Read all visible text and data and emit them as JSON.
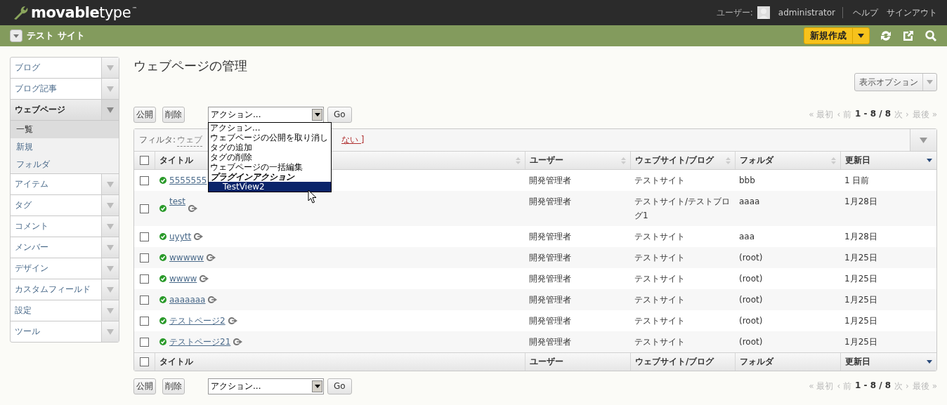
{
  "header": {
    "logo": [
      "movable",
      "type"
    ],
    "trademark": "™",
    "user_label": "ユーザー:",
    "user_name": "administrator",
    "links": [
      "ヘルプ",
      "サインアウト"
    ]
  },
  "site_bar": {
    "site_name": "テスト サイト",
    "new_button": "新規作成"
  },
  "sidebar": {
    "items": [
      {
        "label": "ブログ",
        "selected": false,
        "expanded": false
      },
      {
        "label": "ブログ記事",
        "selected": false,
        "expanded": false
      },
      {
        "label": "ウェブページ",
        "selected": true,
        "expanded": true,
        "children": [
          {
            "label": "一覧",
            "selected": true
          },
          {
            "label": "新規",
            "selected": false
          },
          {
            "label": "フォルダ",
            "selected": false
          }
        ]
      },
      {
        "label": "アイテム",
        "selected": false,
        "expanded": false
      },
      {
        "label": "タグ",
        "selected": false,
        "expanded": false
      },
      {
        "label": "コメント",
        "selected": false,
        "expanded": false
      },
      {
        "label": "メンバー",
        "selected": false,
        "expanded": false
      },
      {
        "label": "デザイン",
        "selected": false,
        "expanded": false
      },
      {
        "label": "カスタムフィールド",
        "selected": false,
        "expanded": false
      },
      {
        "label": "設定",
        "selected": false,
        "expanded": false
      },
      {
        "label": "ツール",
        "selected": false,
        "expanded": false
      }
    ]
  },
  "page_title": "ウェブページの管理",
  "display_options": "表示オプション",
  "actions_top": {
    "buttons": [
      "公開",
      "削除"
    ],
    "select": "アクション...",
    "go": "Go"
  },
  "actions_bottom": {
    "buttons": [
      "公開",
      "削除"
    ],
    "select": "アクション...",
    "go": "Go"
  },
  "action_menu": [
    {
      "kind": "option",
      "label": "アクション...",
      "selected": false
    },
    {
      "kind": "option",
      "label": "ウェブページの公開を取り消し",
      "selected": false
    },
    {
      "kind": "option",
      "label": "タグの追加",
      "selected": false
    },
    {
      "kind": "option",
      "label": "タグの削除",
      "selected": false
    },
    {
      "kind": "option",
      "label": "ウェブページの一括編集",
      "selected": false
    },
    {
      "kind": "group",
      "label": "プラグインアクション",
      "selected": false
    },
    {
      "kind": "option",
      "label": "TestView2",
      "selected": true
    }
  ],
  "pagination": [
    {
      "label": "« 最初",
      "disabled": true
    },
    {
      "label": "‹ 前",
      "disabled": true
    },
    {
      "label": "1 - 8 / 8",
      "disabled": false
    },
    {
      "label": "次 ›",
      "disabled": true
    },
    {
      "label": "最後 »",
      "disabled": true
    }
  ],
  "pagination_bottom": [
    {
      "label": "« 最初",
      "disabled": true
    },
    {
      "label": "‹ 前",
      "disabled": true
    },
    {
      "label": "1 - 8 / 8",
      "disabled": false
    },
    {
      "label": "次 ›",
      "disabled": true
    },
    {
      "label": "最後 »",
      "disabled": true
    }
  ],
  "filter": {
    "label": "フィルタ:",
    "value": "ウェブ",
    "link": "ない ]"
  },
  "table": {
    "select_all_checked": false,
    "footer_select_all_checked": false,
    "columns": [
      {
        "label": "タイトル",
        "sorted": false
      },
      {
        "label": "ユーザー",
        "sorted": false
      },
      {
        "label": "ウェブサイト/ブログ",
        "sorted": false
      },
      {
        "label": "フォルダ",
        "sorted": false
      },
      {
        "label": "更新日",
        "sorted": true
      }
    ],
    "rows": [
      {
        "checked": false,
        "title": "5555555",
        "user": "開発管理者",
        "site": "テストサイト",
        "folder": "bbb",
        "date": "1 日前",
        "view_link": false
      },
      {
        "checked": false,
        "title": "test",
        "user": "開発管理者",
        "site": "テストサイト/テストブログ1",
        "folder": "aaaa",
        "date": "1月28日",
        "view_link": true
      },
      {
        "checked": false,
        "title": "uyytt",
        "user": "開発管理者",
        "site": "テストサイト",
        "folder": "aaa",
        "date": "1月28日",
        "view_link": true
      },
      {
        "checked": false,
        "title": "wwwww",
        "user": "開発管理者",
        "site": "テストサイト",
        "folder": "(root)",
        "date": "1月25日",
        "view_link": true
      },
      {
        "checked": false,
        "title": "wwww",
        "user": "開発管理者",
        "site": "テストサイト",
        "folder": "(root)",
        "date": "1月25日",
        "view_link": true
      },
      {
        "checked": false,
        "title": "aaaaaaa",
        "user": "開発管理者",
        "site": "テストサイト",
        "folder": "(root)",
        "date": "1月25日",
        "view_link": true
      },
      {
        "checked": false,
        "title": "テストページ2",
        "user": "開発管理者",
        "site": "テストサイト",
        "folder": "(root)",
        "date": "1月25日",
        "view_link": true
      },
      {
        "checked": false,
        "title": "テストページ21",
        "user": "開発管理者",
        "site": "テストサイト",
        "folder": "(root)",
        "date": "1月25日",
        "view_link": true
      }
    ],
    "footer_columns": [
      "タイトル",
      "ユーザー",
      "ウェブサイト/ブログ",
      "フォルダ",
      "更新日"
    ]
  }
}
